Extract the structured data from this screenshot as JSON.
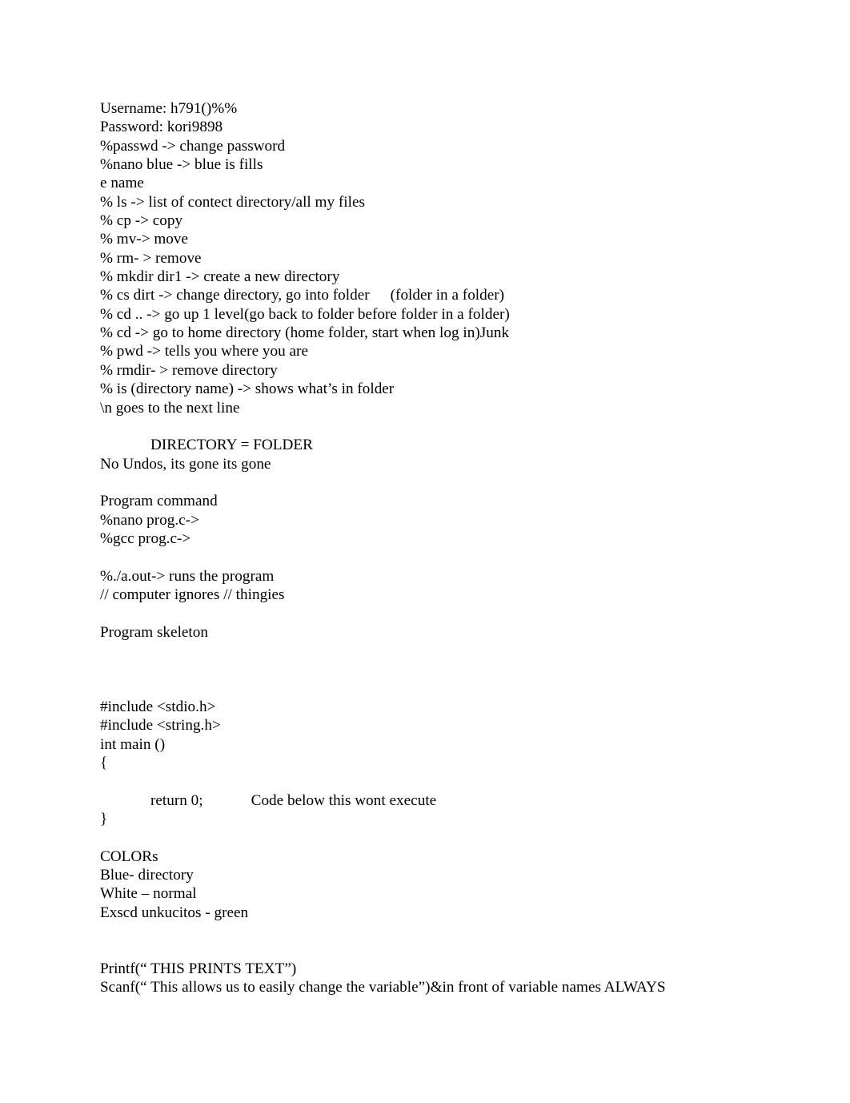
{
  "document": {
    "background_color": "#ffffff",
    "text_color": "#000000",
    "credentials": {
      "username_line": "Username: h791()%%",
      "password_line": "Password: kori9898"
    },
    "command_notes": [
      "%passwd -> change password",
      "%nano blue -> blue is fills",
      "e name",
      "% ls -> list of contect directory/all my files",
      "% cp -> copy",
      "% mv-> move",
      "% rm- > remove",
      "% mkdir dir1 -> create a new directory"
    ],
    "cs_dirt_line": {
      "command": "% cs dirt -> change directory, go into folder",
      "note": "(folder in a folder)"
    },
    "command_notes_2": [
      "% cd .. -> go up 1 level(go back to folder before folder in a folder)",
      "% cd -> go to home directory (home folder, start when log in)Junk",
      "% pwd -> tells you where you are",
      "% rmdir- > remove directory",
      "% is (directory name) -> shows what’s in folder",
      "\\n goes to the next line"
    ],
    "directory_heading": "DIRECTORY = FOLDER",
    "no_undos_line": "No Undos, its gone its gone",
    "program_command": {
      "heading": "Program command",
      "lines": [
        "%nano prog.c->",
        "%gcc prog.c->"
      ]
    },
    "run_notes": [
      "%./a.out-> runs the program",
      "// computer ignores // thingies"
    ],
    "program_skeleton_heading": "Program skeleton",
    "code_skeleton": {
      "include_stdio": "#include <stdio.h>",
      "include_string": "#include <string.h>",
      "main_signature": "int main ()",
      "open_brace": "{",
      "return_statement": "return 0;",
      "return_comment": "Code below this wont execute",
      "close_brace": "}"
    },
    "colors_section": {
      "heading": "COLORs",
      "entries": [
        "Blue- directory",
        "White – normal",
        "Exscd unkucitos - green"
      ]
    },
    "io_functions": [
      "Printf(“ THIS PRINTS TEXT”)",
      "Scanf(“ This allows us to easily change the variable”)&in front of variable names ALWAYS"
    ]
  }
}
